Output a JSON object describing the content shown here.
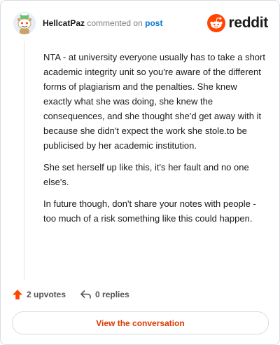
{
  "header": {
    "author": "HellcatPaz",
    "action": "commented on",
    "link_text": "post",
    "logo_text": "reddit"
  },
  "comment": {
    "paragraphs": [
      "NTA - at university everyone usually has to take a short academic integrity unit so you're aware of the different forms of plagiarism and the penalties. She knew exactly what she was doing, she knew the consequences, and she thought she'd get away with it because she didn't expect the work she stole.to be publicised by her academic institution.",
      "She set herself up like this, it's her fault and no one else's.",
      "In future though, don't share your notes with people - too much of a risk something like this could happen."
    ]
  },
  "footer": {
    "upvotes": "2 upvotes",
    "replies": "0 replies"
  },
  "cta": {
    "label": "View the conversation"
  },
  "colors": {
    "reddit_orange": "#ff4500",
    "upvote": "#ff4500",
    "cta_text": "#d93a00",
    "link": "#0079d3"
  },
  "icons": {
    "avatar": "snoo-avatar",
    "logo": "reddit-logo-icon",
    "upvote": "upvote-arrow-icon",
    "reply": "reply-arrow-icon"
  }
}
